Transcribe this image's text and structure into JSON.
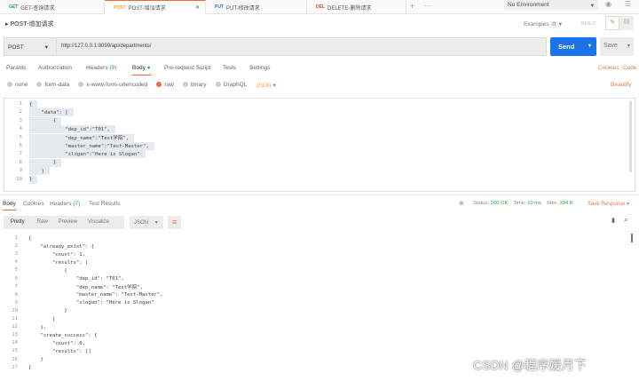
{
  "tabs": [
    {
      "method": "GET",
      "label": "GET-查询请求",
      "color": "#2aa54a"
    },
    {
      "method": "POST",
      "label": "POST-增加请求",
      "color": "#f2a23a"
    },
    {
      "method": "PUT",
      "label": "PUT-修改请求",
      "color": "#2a7ad6"
    },
    {
      "method": "DEL",
      "label": "DELETE-删除请求",
      "color": "#e04a3a"
    }
  ],
  "env": "No Environment",
  "title": "POST-增加请求",
  "examples_label": "Examples",
  "examples_count": "0",
  "build": "BUILD",
  "method": "POST",
  "url": "http://127.0.0.1:8099/api/departments/",
  "send": "Send",
  "save": "Save",
  "req_tabs": [
    "Params",
    "Authorization",
    "Headers",
    "Body",
    "Pre-request Script",
    "Tests",
    "Settings"
  ],
  "headers_count": "(9)",
  "cookies": "Cookies",
  "code": "Code",
  "body_types": [
    "none",
    "form-data",
    "x-www-form-urlencoded",
    "raw",
    "binary",
    "GraphQL"
  ],
  "format": "JSON",
  "beautify": "Beautify",
  "req_lines": [
    "{",
    "    \"data\": [",
    "        {",
    "            \"dep_id\":\"T01\",",
    "            \"dep_name\":\"Test学院\",",
    "            \"master_name\":\"Test-Master\",",
    "            \"slogan\":\"Here is Slogan\"",
    "        }",
    "    ]",
    "}"
  ],
  "resp_tabs": [
    "Body",
    "Cookies",
    "Headers",
    "Test Results"
  ],
  "resp_headers_count": "(7)",
  "status_label": "Status:",
  "status": "200 OK",
  "time_label": "Time:",
  "time": "10 ms",
  "size_label": "Size:",
  "size": "394 B",
  "save_response": "Save Response",
  "views": [
    "Pretty",
    "Raw",
    "Preview",
    "Visualize"
  ],
  "resp_format": "JSON",
  "resp_lines": [
    "{",
    "    \"already_exist\": {",
    "        \"count\": 1,",
    "        \"results\": [",
    "            {",
    "                \"dep_id\": \"T01\",",
    "                \"dep_name\": \"Test学院\",",
    "                \"master_name\": \"Test-Master\",",
    "                \"slogan\": \"Here is Slogan\"",
    "            }",
    "        ]",
    "    },",
    "    \"create_success\": {",
    "        \"count\": 0,",
    "        \"results\": []",
    "    }",
    "}"
  ],
  "watermark": "CSDN @程序媛月下"
}
